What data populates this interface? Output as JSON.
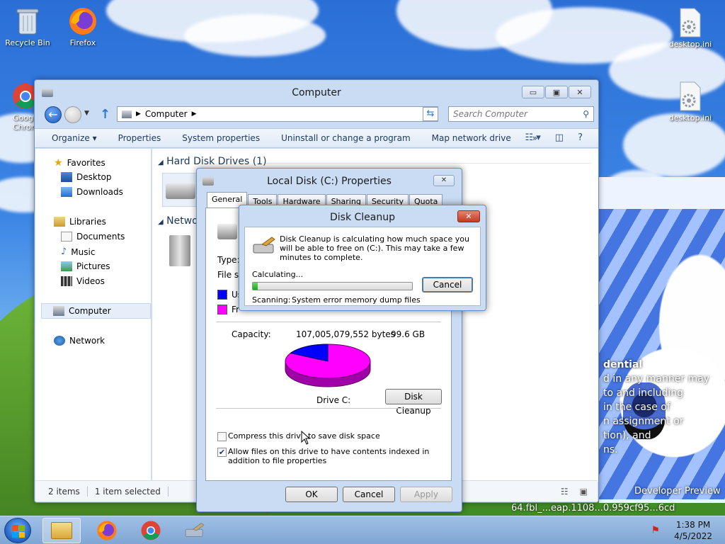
{
  "desktop": {
    "icons": [
      {
        "label": "Recycle Bin",
        "icon": "recycle-bin-icon"
      },
      {
        "label": "Firefox",
        "icon": "firefox-icon"
      },
      {
        "label": "Goog Chron",
        "icon": "chrome-icon"
      },
      {
        "label": "desktop.ini",
        "icon": "settings-file-icon"
      },
      {
        "label": "desktop.ini",
        "icon": "settings-file-icon"
      }
    ],
    "overlay": {
      "title": "dential",
      "lines": [
        "d in any manner may",
        "to and including",
        "in the case of",
        "n assignment or",
        "tion), and",
        "ns."
      ]
    },
    "build_text": [
      "Developer Preview",
      "64.fbl_...eap.1108...0.959cf95...6cd"
    ]
  },
  "explorer": {
    "title": "Computer",
    "address": "Computer",
    "search_placeholder": "Search Computer",
    "toolbar": [
      "Organize ▾",
      "Properties",
      "System properties",
      "Uninstall or change a program",
      "Map network drive",
      "»"
    ],
    "nav": {
      "favorites": "Favorites",
      "desktop": "Desktop",
      "downloads": "Downloads",
      "libraries": "Libraries",
      "documents": "Documents",
      "music": "Music",
      "pictures": "Pictures",
      "videos": "Videos",
      "computer": "Computer",
      "network": "Network"
    },
    "groups": {
      "hard_disks": "Hard Disk Drives (1)",
      "network": "Netwo"
    },
    "status": {
      "items": "2 items",
      "selected": "1 item selected"
    }
  },
  "properties": {
    "title": "Local Disk (C:) Properties",
    "tabs": [
      "General",
      "Tools",
      "Hardware",
      "Sharing",
      "Security",
      "Quota"
    ],
    "type_label": "Type:",
    "fs_label": "File sys",
    "used_label": "Us",
    "free_label": "Fr",
    "capacity_label": "Capacity:",
    "capacity_bytes": "107,005,079,552 bytes",
    "capacity_gb": "99.6 GB",
    "drive_label": "Drive C:",
    "disk_cleanup_button": "Disk Cleanup",
    "compress_label": "Compress this drive to save disk space",
    "compress_checked": false,
    "index_label": "Allow files on this drive to have contents indexed in addition to file properties",
    "index_checked": true,
    "ok": "OK",
    "cancel": "Cancel",
    "apply": "Apply",
    "colors": {
      "used": "#0000ff",
      "free": "#ff00ff"
    },
    "used_fraction": 0.17
  },
  "cleanup": {
    "title": "Disk Cleanup",
    "message": "Disk Cleanup is calculating how much space you will be able to free on  (C:). This may take a few minutes to complete.",
    "calculating": "Calculating...",
    "cancel": "Cancel",
    "scanning_label": "Scanning:",
    "scanning_item": "System error memory dump files",
    "progress": 0.03
  },
  "taskbar": {
    "time": "1:38 PM",
    "date": "4/5/2022"
  }
}
